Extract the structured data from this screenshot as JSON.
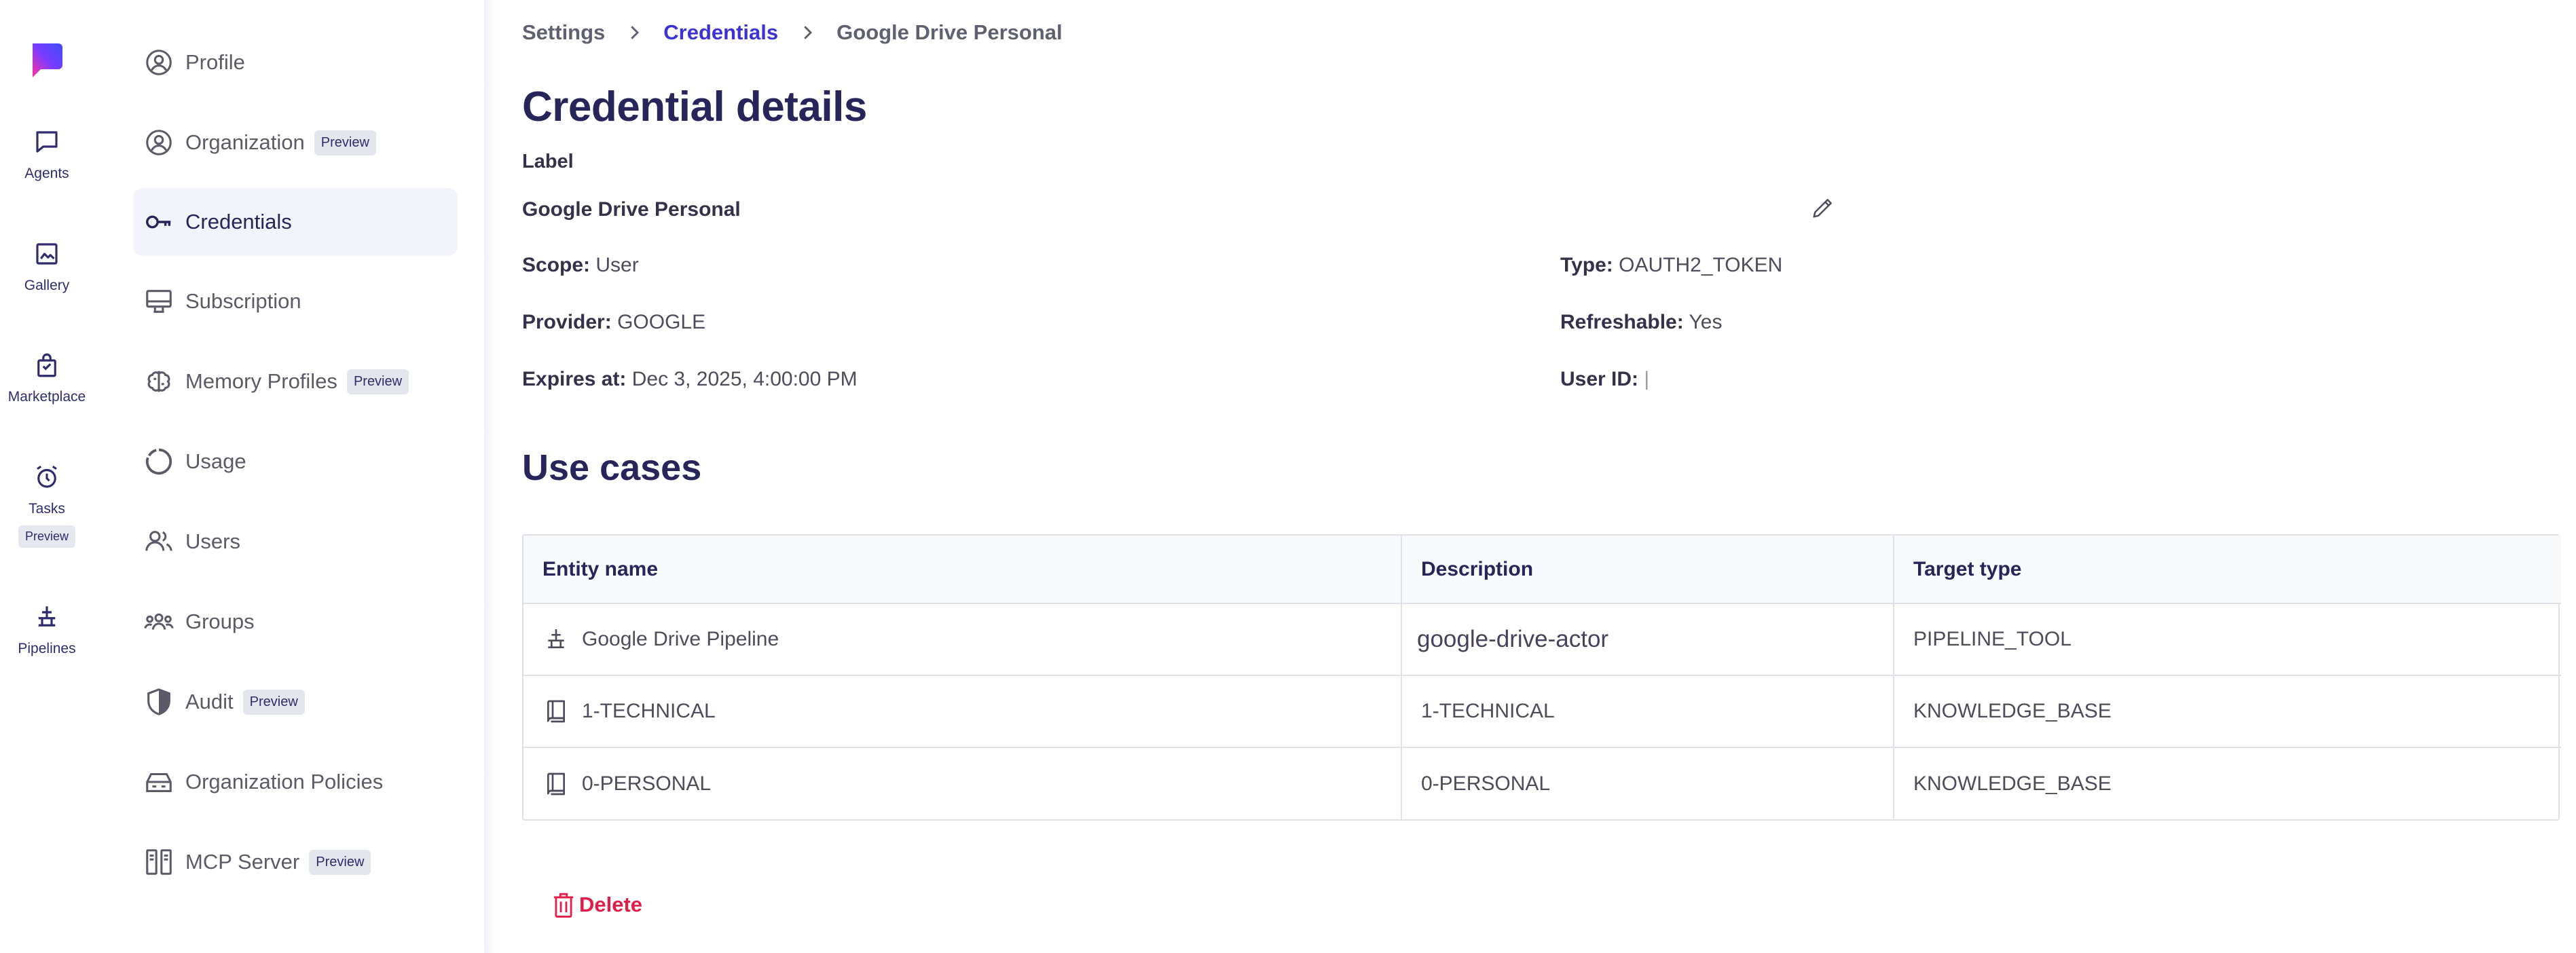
{
  "rail": {
    "items": [
      {
        "label": "Agents",
        "icon": "chat-bubble-icon"
      },
      {
        "label": "Gallery",
        "icon": "image-icon"
      },
      {
        "label": "Marketplace",
        "icon": "shopping-bag-icon"
      },
      {
        "label": "Tasks",
        "icon": "alarm-clock-icon",
        "badge": "Preview"
      },
      {
        "label": "Pipelines",
        "icon": "pipeline-icon"
      }
    ]
  },
  "sidebar": {
    "items": [
      {
        "label": "Profile",
        "icon": "user-circle-icon"
      },
      {
        "label": "Organization",
        "icon": "user-circle-icon",
        "badge": "Preview"
      },
      {
        "label": "Credentials",
        "icon": "key-icon",
        "active": true
      },
      {
        "label": "Subscription",
        "icon": "subscription-icon"
      },
      {
        "label": "Memory Profiles",
        "icon": "brain-icon",
        "badge": "Preview"
      },
      {
        "label": "Usage",
        "icon": "usage-chart-icon"
      },
      {
        "label": "Users",
        "icon": "users-icon"
      },
      {
        "label": "Groups",
        "icon": "groups-icon"
      },
      {
        "label": "Audit",
        "icon": "shield-icon",
        "badge": "Preview"
      },
      {
        "label": "Organization Policies",
        "icon": "policies-icon"
      },
      {
        "label": "MCP Server",
        "icon": "server-icon",
        "badge": "Preview"
      }
    ]
  },
  "breadcrumb": {
    "items": [
      "Settings",
      "Credentials",
      "Google Drive Personal"
    ]
  },
  "page": {
    "title": "Credential details",
    "label_heading": "Label",
    "label_value": "Google Drive Personal"
  },
  "fields": {
    "scope_label": "Scope:",
    "scope_value": "User",
    "type_label": "Type:",
    "type_value": "OAUTH2_TOKEN",
    "provider_label": "Provider:",
    "provider_value": "GOOGLE",
    "refreshable_label": "Refreshable:",
    "refreshable_value": "Yes",
    "expires_label": "Expires at:",
    "expires_value": "Dec 3, 2025, 4:00:00 PM",
    "userid_label": "User ID:",
    "userid_value": "|"
  },
  "use_cases": {
    "title": "Use cases",
    "columns": [
      "Entity name",
      "Description",
      "Target type"
    ],
    "rows": [
      {
        "entity": "Google Drive Pipeline",
        "icon": "pipeline-icon",
        "description": "google-drive-actor",
        "target": "PIPELINE_TOOL"
      },
      {
        "entity": "1-TECHNICAL",
        "icon": "book-icon",
        "description": "1-TECHNICAL",
        "target": "KNOWLEDGE_BASE"
      },
      {
        "entity": "0-PERSONAL",
        "icon": "book-icon",
        "description": "0-PERSONAL",
        "target": "KNOWLEDGE_BASE"
      }
    ]
  },
  "actions": {
    "delete_label": "Delete"
  },
  "colors": {
    "accent": "#3b33d4",
    "heading": "#27255a",
    "danger": "#e11d48",
    "active_bg": "#f3f3fb"
  }
}
